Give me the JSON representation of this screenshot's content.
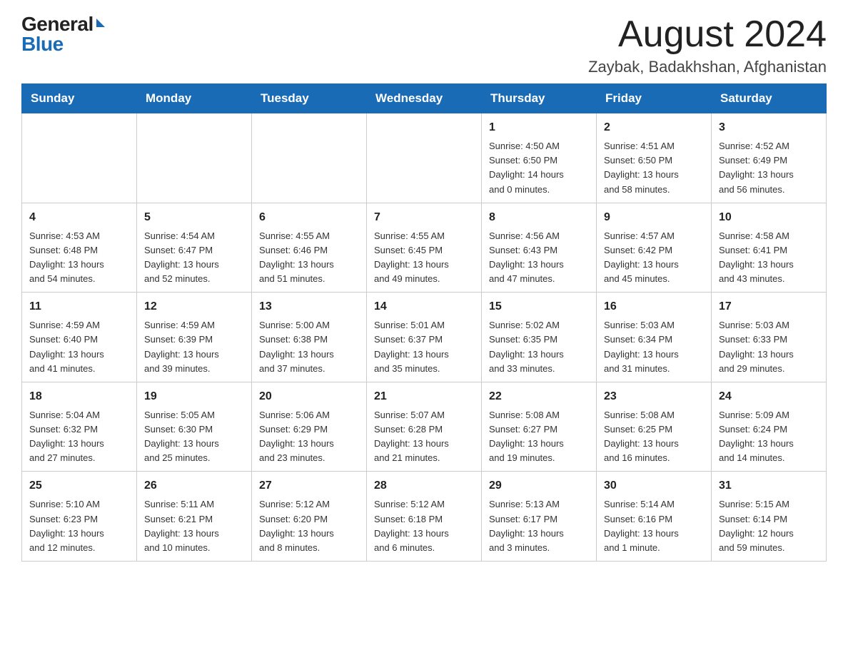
{
  "header": {
    "logo": {
      "general": "General",
      "blue": "Blue"
    },
    "title": "August 2024",
    "location": "Zaybak, Badakhshan, Afghanistan"
  },
  "days_of_week": [
    "Sunday",
    "Monday",
    "Tuesday",
    "Wednesday",
    "Thursday",
    "Friday",
    "Saturday"
  ],
  "weeks": [
    [
      {
        "day": "",
        "info": ""
      },
      {
        "day": "",
        "info": ""
      },
      {
        "day": "",
        "info": ""
      },
      {
        "day": "",
        "info": ""
      },
      {
        "day": "1",
        "info": "Sunrise: 4:50 AM\nSunset: 6:50 PM\nDaylight: 14 hours\nand 0 minutes."
      },
      {
        "day": "2",
        "info": "Sunrise: 4:51 AM\nSunset: 6:50 PM\nDaylight: 13 hours\nand 58 minutes."
      },
      {
        "day": "3",
        "info": "Sunrise: 4:52 AM\nSunset: 6:49 PM\nDaylight: 13 hours\nand 56 minutes."
      }
    ],
    [
      {
        "day": "4",
        "info": "Sunrise: 4:53 AM\nSunset: 6:48 PM\nDaylight: 13 hours\nand 54 minutes."
      },
      {
        "day": "5",
        "info": "Sunrise: 4:54 AM\nSunset: 6:47 PM\nDaylight: 13 hours\nand 52 minutes."
      },
      {
        "day": "6",
        "info": "Sunrise: 4:55 AM\nSunset: 6:46 PM\nDaylight: 13 hours\nand 51 minutes."
      },
      {
        "day": "7",
        "info": "Sunrise: 4:55 AM\nSunset: 6:45 PM\nDaylight: 13 hours\nand 49 minutes."
      },
      {
        "day": "8",
        "info": "Sunrise: 4:56 AM\nSunset: 6:43 PM\nDaylight: 13 hours\nand 47 minutes."
      },
      {
        "day": "9",
        "info": "Sunrise: 4:57 AM\nSunset: 6:42 PM\nDaylight: 13 hours\nand 45 minutes."
      },
      {
        "day": "10",
        "info": "Sunrise: 4:58 AM\nSunset: 6:41 PM\nDaylight: 13 hours\nand 43 minutes."
      }
    ],
    [
      {
        "day": "11",
        "info": "Sunrise: 4:59 AM\nSunset: 6:40 PM\nDaylight: 13 hours\nand 41 minutes."
      },
      {
        "day": "12",
        "info": "Sunrise: 4:59 AM\nSunset: 6:39 PM\nDaylight: 13 hours\nand 39 minutes."
      },
      {
        "day": "13",
        "info": "Sunrise: 5:00 AM\nSunset: 6:38 PM\nDaylight: 13 hours\nand 37 minutes."
      },
      {
        "day": "14",
        "info": "Sunrise: 5:01 AM\nSunset: 6:37 PM\nDaylight: 13 hours\nand 35 minutes."
      },
      {
        "day": "15",
        "info": "Sunrise: 5:02 AM\nSunset: 6:35 PM\nDaylight: 13 hours\nand 33 minutes."
      },
      {
        "day": "16",
        "info": "Sunrise: 5:03 AM\nSunset: 6:34 PM\nDaylight: 13 hours\nand 31 minutes."
      },
      {
        "day": "17",
        "info": "Sunrise: 5:03 AM\nSunset: 6:33 PM\nDaylight: 13 hours\nand 29 minutes."
      }
    ],
    [
      {
        "day": "18",
        "info": "Sunrise: 5:04 AM\nSunset: 6:32 PM\nDaylight: 13 hours\nand 27 minutes."
      },
      {
        "day": "19",
        "info": "Sunrise: 5:05 AM\nSunset: 6:30 PM\nDaylight: 13 hours\nand 25 minutes."
      },
      {
        "day": "20",
        "info": "Sunrise: 5:06 AM\nSunset: 6:29 PM\nDaylight: 13 hours\nand 23 minutes."
      },
      {
        "day": "21",
        "info": "Sunrise: 5:07 AM\nSunset: 6:28 PM\nDaylight: 13 hours\nand 21 minutes."
      },
      {
        "day": "22",
        "info": "Sunrise: 5:08 AM\nSunset: 6:27 PM\nDaylight: 13 hours\nand 19 minutes."
      },
      {
        "day": "23",
        "info": "Sunrise: 5:08 AM\nSunset: 6:25 PM\nDaylight: 13 hours\nand 16 minutes."
      },
      {
        "day": "24",
        "info": "Sunrise: 5:09 AM\nSunset: 6:24 PM\nDaylight: 13 hours\nand 14 minutes."
      }
    ],
    [
      {
        "day": "25",
        "info": "Sunrise: 5:10 AM\nSunset: 6:23 PM\nDaylight: 13 hours\nand 12 minutes."
      },
      {
        "day": "26",
        "info": "Sunrise: 5:11 AM\nSunset: 6:21 PM\nDaylight: 13 hours\nand 10 minutes."
      },
      {
        "day": "27",
        "info": "Sunrise: 5:12 AM\nSunset: 6:20 PM\nDaylight: 13 hours\nand 8 minutes."
      },
      {
        "day": "28",
        "info": "Sunrise: 5:12 AM\nSunset: 6:18 PM\nDaylight: 13 hours\nand 6 minutes."
      },
      {
        "day": "29",
        "info": "Sunrise: 5:13 AM\nSunset: 6:17 PM\nDaylight: 13 hours\nand 3 minutes."
      },
      {
        "day": "30",
        "info": "Sunrise: 5:14 AM\nSunset: 6:16 PM\nDaylight: 13 hours\nand 1 minute."
      },
      {
        "day": "31",
        "info": "Sunrise: 5:15 AM\nSunset: 6:14 PM\nDaylight: 12 hours\nand 59 minutes."
      }
    ]
  ]
}
